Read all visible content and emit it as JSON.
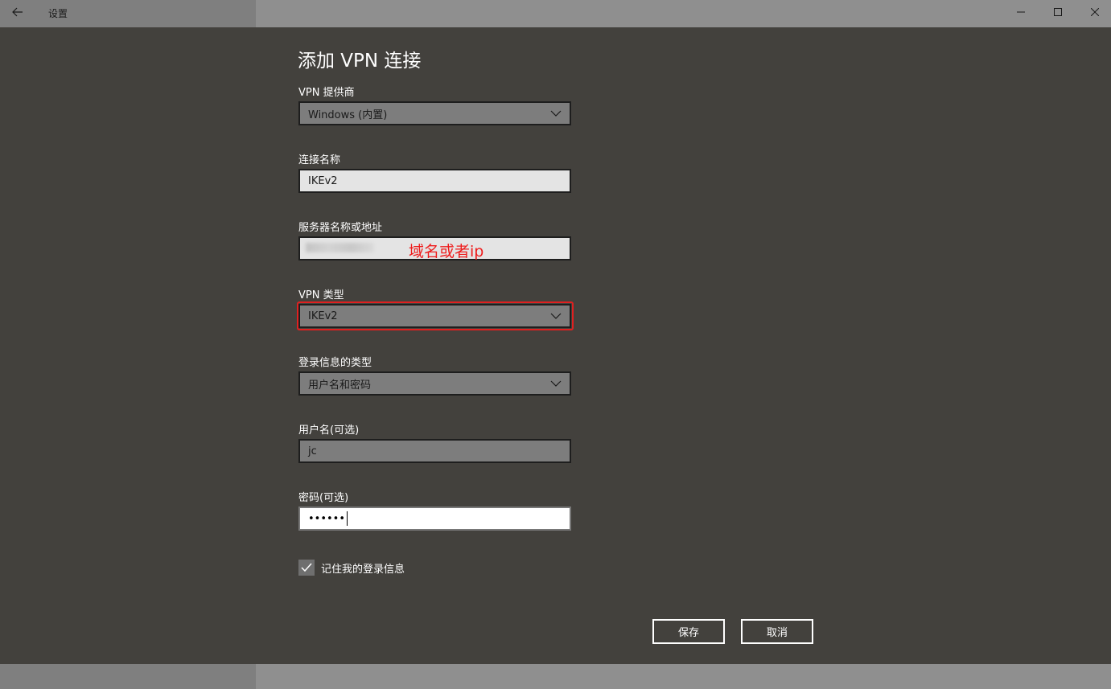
{
  "window": {
    "title": "设置",
    "back_icon": "arrow-left-icon",
    "controls": [
      "minimize-icon",
      "maximize-icon",
      "close-icon"
    ]
  },
  "dialog": {
    "title": "添加 VPN 连接",
    "fields": {
      "provider": {
        "label": "VPN 提供商",
        "value": "Windows (内置)"
      },
      "connection_name": {
        "label": "连接名称",
        "value": "IKEv2"
      },
      "server": {
        "label": "服务器名称或地址",
        "value": "",
        "annotation": "域名或者ip"
      },
      "vpn_type": {
        "label": "VPN 类型",
        "value": "IKEv2"
      },
      "signin_type": {
        "label": "登录信息的类型",
        "value": "用户名和密码"
      },
      "username": {
        "label": "用户名(可选)",
        "value": "jc"
      },
      "password": {
        "label": "密码(可选)",
        "value": "••••••"
      }
    },
    "remember": {
      "label": "记住我的登录信息",
      "checked": true
    },
    "buttons": {
      "save": "保存",
      "cancel": "取消"
    }
  },
  "colors": {
    "overlay": "#43413d",
    "highlight": "#e02020",
    "annotation": "#ee1c1c"
  }
}
